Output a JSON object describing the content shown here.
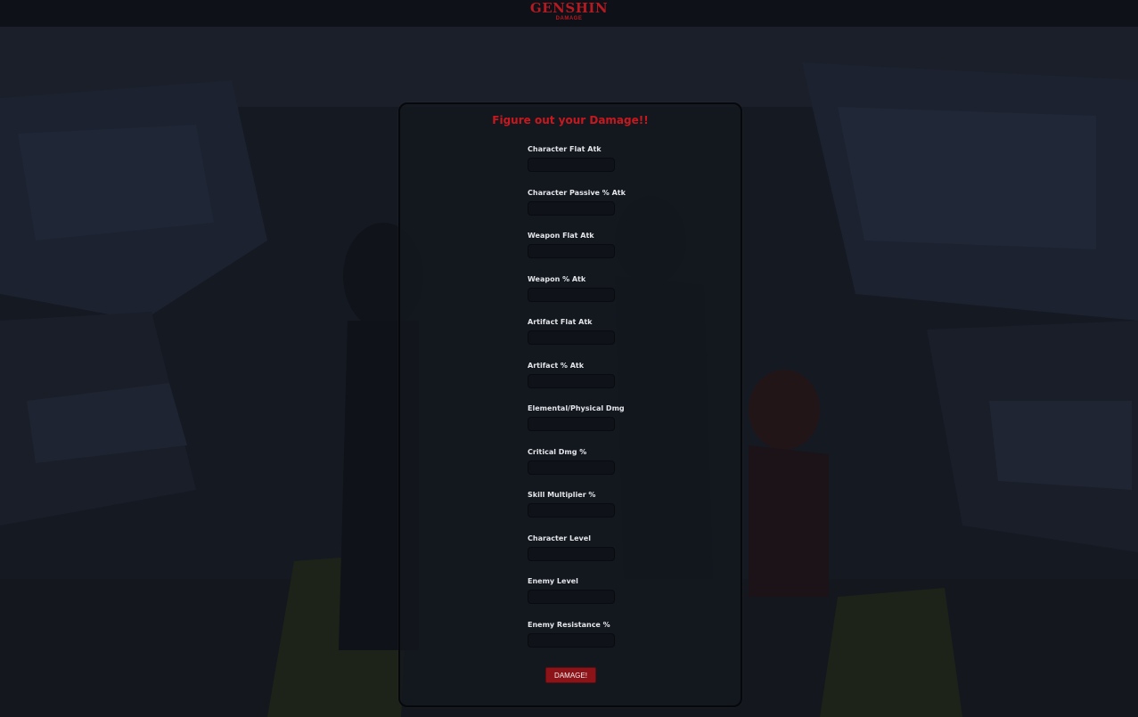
{
  "header": {
    "logo_text": "GENSHIN",
    "logo_subtext": "DAMAGE"
  },
  "form": {
    "title": "Figure out your Damage!!",
    "fields": [
      {
        "label": "Character Flat Atk",
        "value": ""
      },
      {
        "label": "Character Passive % Atk",
        "value": ""
      },
      {
        "label": "Weapon Flat Atk",
        "value": ""
      },
      {
        "label": "Weapon % Atk",
        "value": ""
      },
      {
        "label": "Artifact Flat Atk",
        "value": ""
      },
      {
        "label": "Artifact % Atk",
        "value": ""
      },
      {
        "label": "Elemental/Physical Dmg",
        "value": ""
      },
      {
        "label": "Critical Dmg %",
        "value": ""
      },
      {
        "label": "Skill Multiplier %",
        "value": ""
      },
      {
        "label": "Character Level",
        "value": ""
      },
      {
        "label": "Enemy Level",
        "value": ""
      },
      {
        "label": "Enemy Resistance %",
        "value": ""
      }
    ],
    "submit_label": "DAMAGE!"
  },
  "colors": {
    "accent_red": "#c8181f",
    "button_red": "#8c1418",
    "panel_bg": "#14171f",
    "page_bg": "#12151c"
  }
}
